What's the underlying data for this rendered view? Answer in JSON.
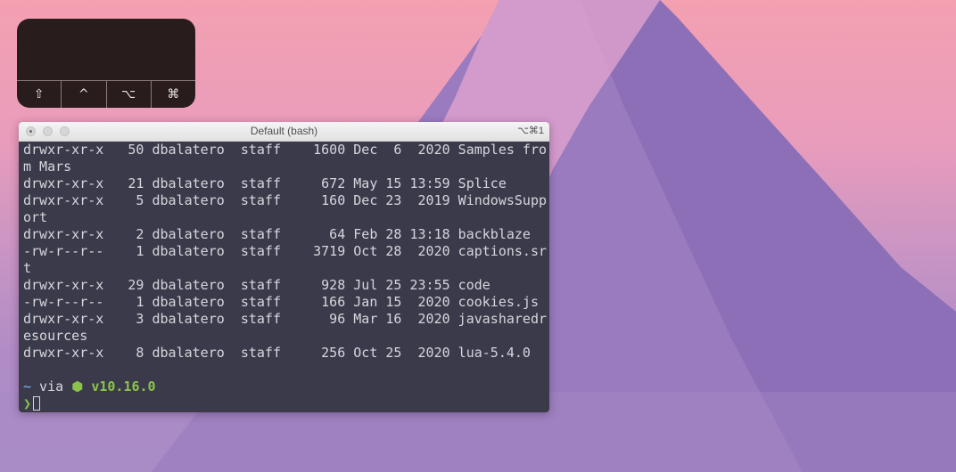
{
  "overlay": {
    "keys": [
      {
        "label": "⇧",
        "icon": "shift-key-icon"
      },
      {
        "label": "^",
        "icon": "control-key-icon"
      },
      {
        "label": "⌥",
        "icon": "option-key-icon"
      },
      {
        "label": "⌘",
        "icon": "command-key-icon"
      }
    ]
  },
  "terminal": {
    "title": "Default (bash)",
    "shortcut": "⌥⌘1",
    "lines": [
      "drwxr-xr-x   50 dbalatero  staff    1600 Dec  6  2020 Samples fro",
      "m Mars",
      "drwxr-xr-x   21 dbalatero  staff     672 May 15 13:59 Splice",
      "drwxr-xr-x    5 dbalatero  staff     160 Dec 23  2019 WindowsSupp",
      "ort",
      "drwxr-xr-x    2 dbalatero  staff      64 Feb 28 13:18 backblaze",
      "-rw-r--r--    1 dbalatero  staff    3719 Oct 28  2020 captions.sr",
      "t",
      "drwxr-xr-x   29 dbalatero  staff     928 Jul 25 23:55 code",
      "-rw-r--r--    1 dbalatero  staff     166 Jan 15  2020 cookies.js",
      "drwxr-xr-x    3 dbalatero  staff      96 Mar 16  2020 javasharedr",
      "esources",
      "drwxr-xr-x    8 dbalatero  staff     256 Oct 25  2020 lua-5.4.0",
      ""
    ],
    "prompt": {
      "tilde": "~",
      "via": " via ",
      "node_icon": "⬢",
      "node_version": "v10.16.0",
      "arrow": "❯"
    }
  }
}
